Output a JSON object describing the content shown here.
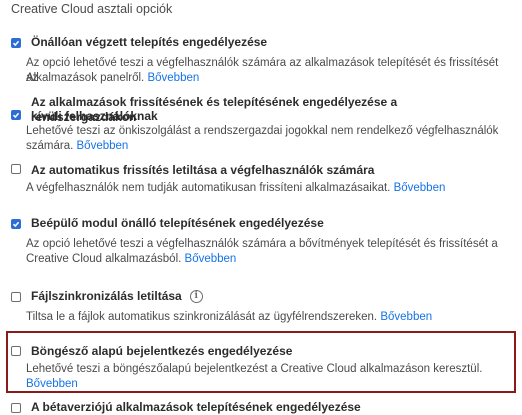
{
  "section_title": "Creative Cloud asztali opciók",
  "options": [
    {
      "checked": true,
      "label": "Önállóan végzett telepítés engedélyezése",
      "desc1": "Az opció lehetővé teszi a végfelhasználók számára az alkalmazások telepítését és frissítését az",
      "desc2": "Alkalmazások panelről.",
      "link": "Bővebben"
    },
    {
      "checked": true,
      "label1": "Az alkalmazások frissítésének és telepítésének engedélyezése a rendszergazdákon",
      "label2": "kívüli felhasználóknak",
      "desc1": "Lehetővé teszi az önkiszolgálást a rendszergazdai jogokkal nem rendelkező végfelhasználók",
      "desc2": "számára.",
      "link": "Bővebben"
    },
    {
      "checked": false,
      "label": "Az automatikus frissítés letiltása a végfelhasználók számára",
      "desc1": "A végfelhasználók nem tudják automatikusan frissíteni alkalmazásaikat.",
      "link": "Bővebben"
    },
    {
      "checked": true,
      "label": "Beépülő modul önálló telepítésének engedélyezése",
      "desc1": "Az opció lehetővé teszi a végfelhasználók számára a bővítmények telepítését és frissítését a",
      "desc2": "Creative Cloud alkalmazásból.",
      "link": "Bővebben"
    },
    {
      "checked": false,
      "label": "Fájlszinkronizálás letiltása",
      "info_icon": "info-icon",
      "info_glyph": "i",
      "desc1": "Tiltsa le a fájlok automatikus szinkronizálását az ügyfélrendszereken.",
      "link": "Bővebben"
    },
    {
      "checked": false,
      "label": "Böngésző alapú bejelentkezés engedélyezése",
      "desc1": "Lehetővé teszi a böngészőalapú bejelentkezést a Creative Cloud alkalmazáson keresztül.",
      "link": "Bővebben"
    },
    {
      "checked": false,
      "label": "A bétaverziójú alkalmazások telepítésének engedélyezése"
    }
  ],
  "colors": {
    "accent": "#2c6ed5",
    "link": "#1473e6",
    "highlight_border": "#8b1a1a"
  }
}
